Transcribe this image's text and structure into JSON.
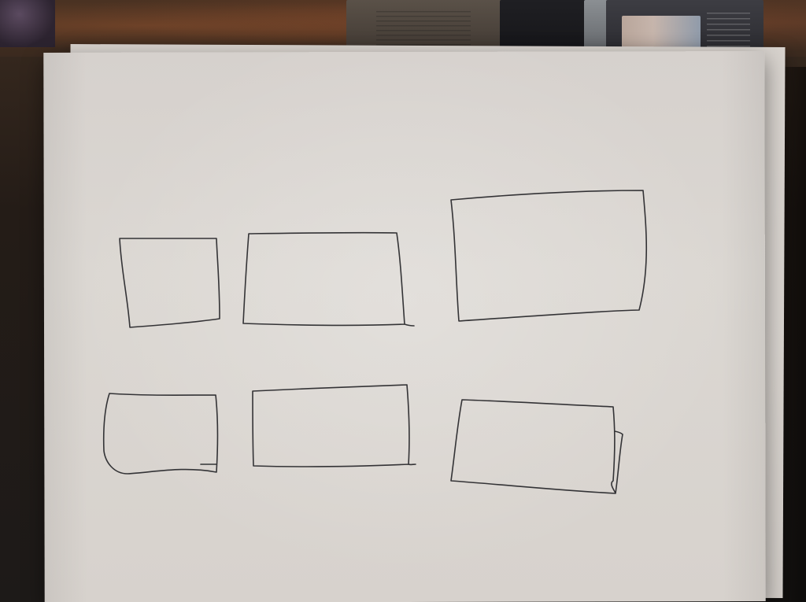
{
  "scene": {
    "subject": "hand-drawn-wireframe-rectangles-on-paper"
  }
}
